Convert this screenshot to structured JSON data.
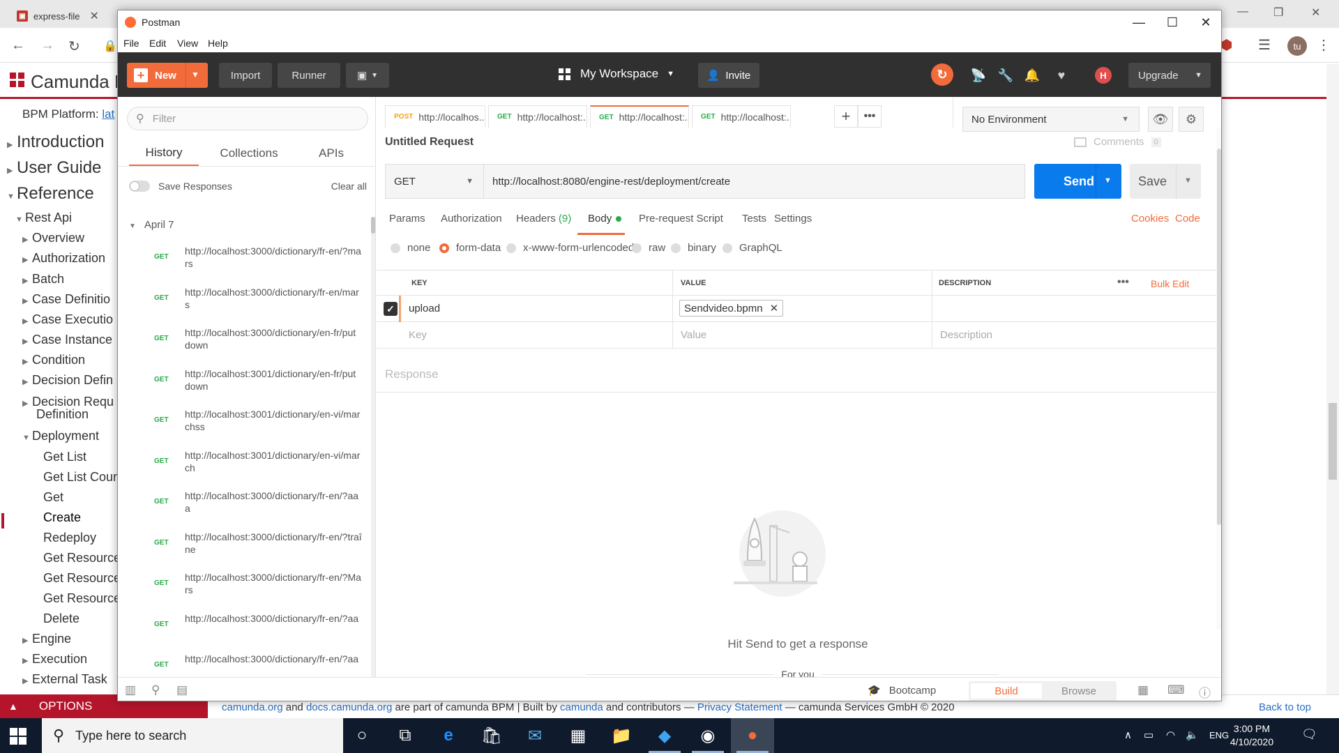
{
  "browser": {
    "tabs": [
      {
        "title": "express-file"
      },
      {
        "title": ""
      },
      {
        "title": ""
      },
      {
        "title": ""
      },
      {
        "title": ""
      },
      {
        "title": ""
      },
      {
        "title": ""
      },
      {
        "title": ""
      },
      {
        "title": ""
      }
    ],
    "profile_initials": "tu"
  },
  "site": {
    "title": "Camunda B",
    "bpm_platform_label": "BPM Platform:",
    "bpm_platform_link": "lat",
    "nav": [
      {
        "label": "Introduction",
        "level": 0,
        "expanded": false
      },
      {
        "label": "User Guide",
        "level": 0,
        "expanded": false
      },
      {
        "label": "Reference",
        "level": 0,
        "expanded": true
      },
      {
        "label": "Rest Api",
        "level": 1,
        "expanded": true
      },
      {
        "label": "Overview",
        "level": 2,
        "expanded": false
      },
      {
        "label": "Authorization",
        "level": 2,
        "expanded": false
      },
      {
        "label": "Batch",
        "level": 2,
        "expanded": false
      },
      {
        "label": "Case Definitio",
        "level": 2,
        "expanded": false
      },
      {
        "label": "Case Executio",
        "level": 2,
        "expanded": false
      },
      {
        "label": "Case Instance",
        "level": 2,
        "expanded": false
      },
      {
        "label": "Condition",
        "level": 2,
        "expanded": false
      },
      {
        "label": "Decision Defin",
        "level": 2,
        "expanded": false
      },
      {
        "label": "Decision Requ",
        "level": 2,
        "expanded": false
      },
      {
        "label": "Definition",
        "level": 2,
        "expanded": false
      },
      {
        "label": "Deployment",
        "level": 2,
        "expanded": true
      },
      {
        "label": "Get List",
        "level": 3
      },
      {
        "label": "Get List Coun",
        "level": 3
      },
      {
        "label": "Get",
        "level": 3
      },
      {
        "label": "Create",
        "level": 3,
        "active": true
      },
      {
        "label": "Redeploy",
        "level": 3
      },
      {
        "label": "Get Resource",
        "level": 3
      },
      {
        "label": "Get Resource",
        "level": 3
      },
      {
        "label": "Get Resource",
        "level": 3
      },
      {
        "label": "Delete",
        "level": 3
      },
      {
        "label": "Engine",
        "level": 2,
        "expanded": false
      },
      {
        "label": "Execution",
        "level": 2,
        "expanded": false
      },
      {
        "label": "External Task",
        "level": 2,
        "expanded": false
      }
    ],
    "options_label": "OPTIONS",
    "footer": {
      "link1": "camunda.org",
      "and": " and ",
      "link2": "docs.camunda.org",
      "text1": " are part of camunda BPM | Built by ",
      "link3": "camunda",
      "text2": " and contributors — ",
      "link4": "Privacy Statement",
      "text3": " — camunda Services GmbH © 2020"
    },
    "back_to_top": "Back to top"
  },
  "postman": {
    "window_title": "Postman",
    "menu": [
      "File",
      "Edit",
      "View",
      "Help"
    ],
    "header": {
      "new_label": "New",
      "import_label": "Import",
      "runner_label": "Runner",
      "workspace_label": "My Workspace",
      "invite_label": "Invite",
      "avatar_initial": "H",
      "upgrade_label": "Upgrade"
    },
    "sidebar": {
      "filter_placeholder": "Filter",
      "tabs": [
        "History",
        "Collections",
        "APIs"
      ],
      "save_responses_label": "Save Responses",
      "clear_all_label": "Clear all",
      "date_group": "April 7",
      "history": [
        {
          "method": "GET",
          "url": "http://localhost:3000/dictionary/fr-en/?mars"
        },
        {
          "method": "GET",
          "url": "http://localhost:3000/dictionary/fr-en/mars"
        },
        {
          "method": "GET",
          "url": "http://localhost:3000/dictionary/en-fr/put down"
        },
        {
          "method": "GET",
          "url": "http://localhost:3001/dictionary/en-fr/put down"
        },
        {
          "method": "GET",
          "url": "http://localhost:3001/dictionary/en-vi/marchss"
        },
        {
          "method": "GET",
          "url": "http://localhost:3001/dictionary/en-vi/march"
        },
        {
          "method": "GET",
          "url": "http://localhost:3000/dictionary/fr-en/?aaa"
        },
        {
          "method": "GET",
          "url": "http://localhost:3000/dictionary/fr-en/?traîne"
        },
        {
          "method": "GET",
          "url": "http://localhost:3000/dictionary/fr-en/?Mars"
        },
        {
          "method": "GET",
          "url": "http://localhost:3000/dictionary/fr-en/?aa"
        },
        {
          "method": "GET",
          "url": "http://localhost:3000/dictionary/fr-en/?aa"
        }
      ]
    },
    "request_tabs": [
      {
        "method": "POST",
        "url": "http://localhos...",
        "color": "#f4a21b"
      },
      {
        "method": "GET",
        "url": "http://localhost:...",
        "color": "#2aaa4a"
      },
      {
        "method": "GET",
        "url": "http://localhost:...",
        "color": "#2aaa4a",
        "active": true
      },
      {
        "method": "GET",
        "url": "http://localhost:...",
        "color": "#2aaa4a"
      }
    ],
    "environment": "No Environment",
    "request": {
      "name": "Untitled Request",
      "comments_label": "Comments",
      "comments_count": "0",
      "method": "GET",
      "url": "http://localhost:8080/engine-rest/deployment/create",
      "send_label": "Send",
      "save_label": "Save"
    },
    "sub_tabs": {
      "params": "Params",
      "authorization": "Authorization",
      "headers": "Headers",
      "headers_count": "(9)",
      "body": "Body",
      "prerequest": "Pre-request Script",
      "tests": "Tests",
      "settings": "Settings",
      "cookies": "Cookies",
      "code": "Code"
    },
    "body_types": [
      {
        "label": "none",
        "selected": false
      },
      {
        "label": "form-data",
        "selected": true
      },
      {
        "label": "x-www-form-urlencoded",
        "selected": false
      },
      {
        "label": "raw",
        "selected": false
      },
      {
        "label": "binary",
        "selected": false
      },
      {
        "label": "GraphQL",
        "selected": false
      }
    ],
    "kv_table": {
      "headers": {
        "key": "KEY",
        "value": "VALUE",
        "description": "DESCRIPTION"
      },
      "bulk_edit": "Bulk Edit",
      "row": {
        "key": "upload",
        "file": "Sendvideo.bpmn"
      },
      "placeholders": {
        "key": "Key",
        "value": "Value",
        "description": "Description"
      }
    },
    "response": {
      "label": "Response",
      "hint": "Hit Send to get a response",
      "for_you": "For you"
    },
    "status_bar": {
      "bootcamp": "Bootcamp",
      "build": "Build",
      "browse": "Browse"
    }
  },
  "taskbar": {
    "search_placeholder": "Type here to search",
    "language": "ENG",
    "time": "3:00 PM",
    "date": "4/10/2020"
  },
  "colors": {
    "postman_orange": "#f26b3a",
    "send_blue": "#097bed",
    "camunda_red": "#b5152b",
    "get_green": "#2aaa4a"
  }
}
